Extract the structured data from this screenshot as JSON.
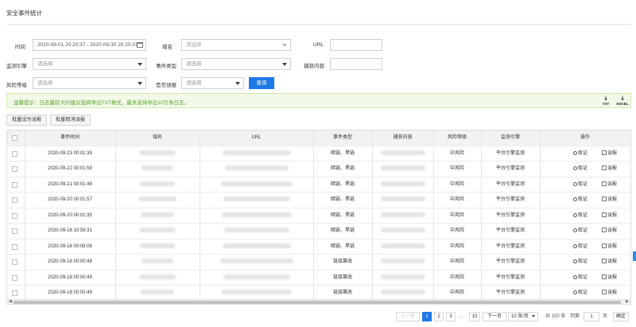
{
  "page": {
    "title": "安全事件统计"
  },
  "filters": {
    "time_label": "时间",
    "time_value": "2020-09-01 20:20:37 - 2020-09-30 20:20:37",
    "domain_label": "域名",
    "domain_placeholder": "请选择",
    "url_label": "URL",
    "engine_label": "监测引擎",
    "engine_placeholder": "请选择",
    "event_type_label": "事件类型",
    "event_type_placeholder": "请选择",
    "capture_label": "捕获内容",
    "risk_label": "风险等级",
    "risk_placeholder": "请选择",
    "false_report_label": "是否误报",
    "false_report_placeholder": "请选择",
    "query_button": "查询"
  },
  "tip": {
    "text": "温馨提示：日志量较大时建议选择导出TXT格式，最多支持导出10万条日志。",
    "export_txt": "TXT",
    "export_excel": "EXCEL"
  },
  "toolbar": {
    "batch_set": "批量设为误报",
    "batch_cancel": "批量取消误报"
  },
  "table": {
    "columns": [
      "事件时间",
      "域名",
      "URL",
      "事件类型",
      "捕获内容",
      "风险等级",
      "监测引擎",
      "操作"
    ],
    "op_evidence": "取证",
    "op_false": "误报",
    "rows": [
      {
        "time": "2020-09-23 00:01:39",
        "type": "暗链、黑链",
        "risk": "中风险",
        "engine": "平台引擎监测"
      },
      {
        "time": "2020-09-22 00:01:59",
        "type": "暗链、黑链",
        "risk": "中风险",
        "engine": "平台引擎监测"
      },
      {
        "time": "2020-09-21 00:01:49",
        "type": "暗链、黑链",
        "risk": "中风险",
        "engine": "平台引擎监测"
      },
      {
        "time": "2020-09-20 00:01:57",
        "type": "暗链、黑链",
        "risk": "中风险",
        "engine": "平台引擎监测"
      },
      {
        "time": "2020-09-20 00:01:35",
        "type": "暗链、黑链",
        "risk": "中风险",
        "engine": "平台引擎监测"
      },
      {
        "time": "2020-09-18 10:59:31",
        "type": "暗链、黑链",
        "risk": "中风险",
        "engine": "平台引擎监测"
      },
      {
        "time": "2020-09-18 00:08:08",
        "type": "暗链、黑链",
        "risk": "中风险",
        "engine": "平台引擎监测"
      },
      {
        "time": "2020-09-18 00:00:49",
        "type": "链接篡改",
        "risk": "中风险",
        "engine": "平台引擎监测"
      },
      {
        "time": "2020-09-18 00:00:49",
        "type": "链接篡改",
        "risk": "中风险",
        "engine": "平台引擎监测"
      },
      {
        "time": "2020-09-18 00:00:49",
        "type": "链接篡改",
        "risk": "中风险",
        "engine": "平台引擎监测"
      }
    ]
  },
  "pagination": {
    "prev": "上一页",
    "pages": [
      "1",
      "2",
      "3"
    ],
    "ellipsis": "...",
    "last": "10",
    "next": "下一页",
    "page_size": "10 条/页",
    "total": "共 100 条",
    "goto_label": "到第",
    "goto_value": "1",
    "page_unit": "页",
    "confirm": "确定"
  }
}
